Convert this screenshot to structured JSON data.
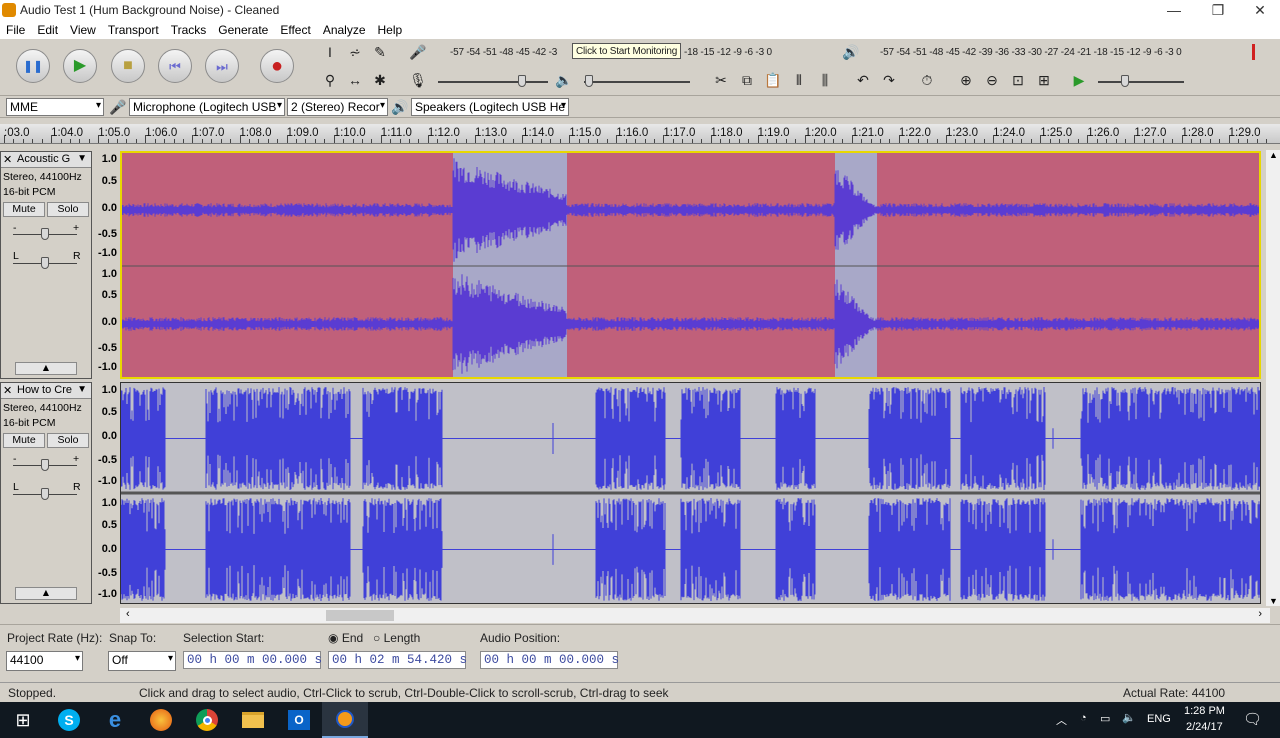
{
  "window": {
    "title": "Audio Test 1 (Hum Background Noise) - Cleaned",
    "min_icon": "minimize-icon",
    "max_icon": "restore-icon",
    "close_icon": "close-icon"
  },
  "menu": [
    "File",
    "Edit",
    "View",
    "Transport",
    "Tracks",
    "Generate",
    "Effect",
    "Analyze",
    "Help"
  ],
  "transport": [
    {
      "name": "pause",
      "glyph": "❚❚",
      "color": "#2a6ccf"
    },
    {
      "name": "play",
      "glyph": "▶",
      "color": "#2a9a2a"
    },
    {
      "name": "stop",
      "glyph": "■",
      "color": "#b8a040"
    },
    {
      "name": "skip-start",
      "glyph": "⏮",
      "color": "#6a6ad0"
    },
    {
      "name": "skip-end",
      "glyph": "⏭",
      "color": "#6a6ad0"
    },
    {
      "name": "record",
      "glyph": "●",
      "color": "#c82020"
    }
  ],
  "meters": {
    "record_scale": "-57 -54 -51 -48 -45 -42 -3",
    "monitor_tooltip": "Click to Start Monitoring",
    "record_scale_tail": "-18 -15 -12 -9 -6 -3 0",
    "play_scale": "-57 -54 -51 -48 -45 -42 -39 -36 -33 -30 -27 -24 -21 -18 -15 -12 -9 -6 -3 0"
  },
  "devices": {
    "host": "MME",
    "mic": "Microphone (Logitech USB",
    "channels": "2 (Stereo) Recor",
    "speakers": "Speakers (Logitech USB He"
  },
  "ruler": [
    "03.0",
    "1:04.0",
    "1:05.0",
    "1:06.0",
    "1:07.0",
    "1:08.0",
    "1:09.0",
    "1:10.0",
    "1:11.0",
    "1:12.0",
    "1:13.0",
    "1:14.0",
    "1:15.0",
    "1:16.0",
    "1:17.0",
    "1:18.0",
    "1:19.0",
    "1:20.0",
    "1:21.0",
    "1:22.0",
    "1:23.0",
    "1:24.0",
    "1:25.0",
    "1:26.0",
    "1:27.0",
    "1:28.0",
    "1:29.0"
  ],
  "tracks": [
    {
      "name": "Acoustic G",
      "rate": "Stereo, 44100Hz",
      "format": "16-bit PCM",
      "mute": "Mute",
      "solo": "Solo",
      "pan_l": "L",
      "pan_r": "R",
      "gain_minus": "-",
      "gain_plus": "+",
      "scale": [
        "1.0",
        "0.5",
        "0.0",
        "-0.5",
        "-1.0"
      ]
    },
    {
      "name": "How to Cre",
      "rate": "Stereo, 44100Hz",
      "format": "16-bit PCM",
      "mute": "Mute",
      "solo": "Solo",
      "pan_l": "L",
      "pan_r": "R",
      "gain_minus": "-",
      "gain_plus": "+",
      "scale": [
        "1.0",
        "0.5",
        "0.0",
        "-0.5",
        "-1.0"
      ]
    }
  ],
  "selection": {
    "rate_label": "Project Rate (Hz):",
    "rate_value": "44100",
    "snap_label": "Snap To:",
    "snap_value": "Off",
    "start_label": "Selection Start:",
    "end_label": "End",
    "length_label": "Length",
    "start_value": "00 h 00 m 00.000 s",
    "end_value": "00 h 02 m 54.420 s",
    "pos_label": "Audio Position:",
    "pos_value": "00 h 00 m 00.000 s"
  },
  "status": {
    "state": "Stopped.",
    "hint": "Click and drag to select audio, Ctrl-Click to scrub, Ctrl-Double-Click to scroll-scrub, Ctrl-drag to seek",
    "rate": "Actual Rate: 44100"
  },
  "taskbar": {
    "apps": [
      "windows-start-icon",
      "skype-icon",
      "edge-icon",
      "firefox-icon",
      "chrome-icon",
      "file-explorer-icon",
      "outlook-icon",
      "audacity-icon"
    ],
    "lang": "ENG",
    "time": "1:28 PM",
    "date": "2/24/17"
  }
}
